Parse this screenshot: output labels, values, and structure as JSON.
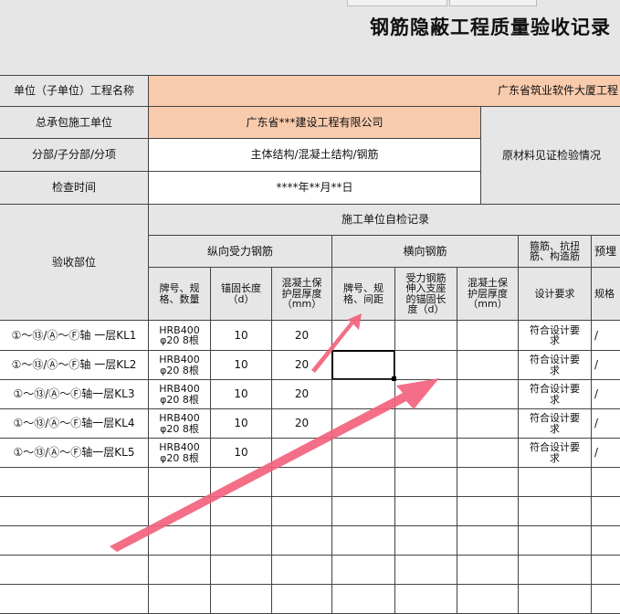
{
  "sheet": {
    "title": "钢筋隐蔽工程质量验收记录",
    "header": {
      "unit_name_label": "单位（子单位）工程名称",
      "unit_name_value": "广东省筑业软件大厦工程",
      "contractor_label": "总承包施工单位",
      "contractor_value": "广东省***建设工程有限公司",
      "material_label": "原材料见证检验情况",
      "subdivision_label": "分部/子分部/分项",
      "subdivision_value": "主体结构/混凝土结构/钢筋",
      "inspect_time_label": "检查时间",
      "inspect_time_value": "****年**月**日"
    },
    "table": {
      "location_header": "验收部位",
      "self_check_header": "施工单位自检记录",
      "longitudinal_header": "纵向受力钢筋",
      "transverse_header": "横向钢筋",
      "stirrup_header": "箍筋、抗扭\n筋、构造筋",
      "embedded_header": "预埋",
      "col_grade": "牌号、规\n格、数量",
      "col_anchor": "锚固长度\n（d）",
      "col_cover": "混凝土保\n护层厚度\n（mm）",
      "col_t_grade": "牌号、规\n格、间距",
      "col_t_anchor": "受力钢筋\n伸入支座\n的锚固长\n度（d）",
      "col_t_cover": "混凝土保\n护层厚度\n（mm）",
      "col_design": "设计要求",
      "col_embed_spec": "规格"
    },
    "rows": [
      {
        "location": "①～⑬/Ⓐ～Ⓕ轴 一层KL1",
        "grade": "HRB400\nφ20 8根",
        "anchor": "10",
        "cover": "20",
        "design": "符合设计要\n求",
        "embed": "/"
      },
      {
        "location": "①～⑬/Ⓐ～Ⓕ轴 一层KL2",
        "grade": "HRB400\nφ20 8根",
        "anchor": "10",
        "cover": "20",
        "design": "符合设计要\n求",
        "embed": "/"
      },
      {
        "location": "①～⑬/Ⓐ～Ⓕ轴一层KL3",
        "grade": "HRB400\nφ20 8根",
        "anchor": "10",
        "cover": "20",
        "design": "符合设计要\n求",
        "embed": "/"
      },
      {
        "location": "①～⑬/Ⓐ～Ⓕ轴一层KL4",
        "grade": "HRB400\nφ20 8根",
        "anchor": "10",
        "cover": "20",
        "design": "符合设计要\n求",
        "embed": "/"
      },
      {
        "location": "①～⑬/Ⓐ～Ⓕ轴一层KL5",
        "grade": "HRB400\nφ20 8根",
        "anchor": "10",
        "cover": "",
        "design": "符合设计要\n求",
        "embed": "/"
      }
    ],
    "annotation_color": "#f2627c"
  }
}
